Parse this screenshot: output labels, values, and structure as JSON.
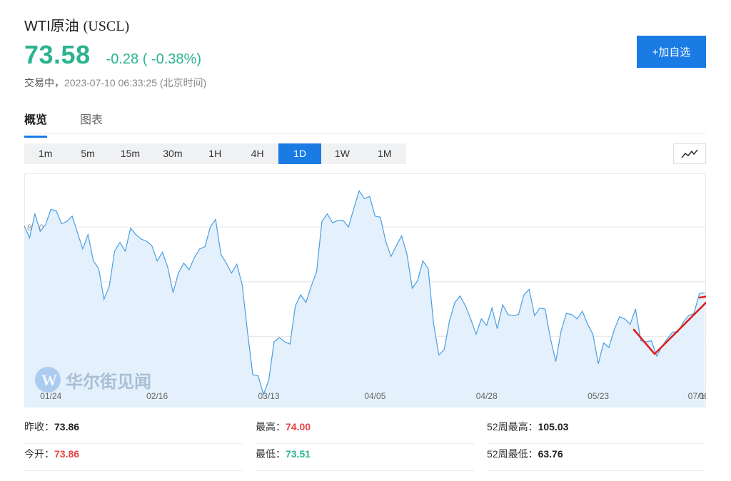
{
  "header": {
    "name": "WTI原油",
    "code": "(USCL)",
    "price": "73.58",
    "change": "-0.28 ( -0.38%)",
    "status_prefix": "交易中，",
    "timestamp": "2023-07-10 06:33:25 (北京时间)",
    "add_button": "+加自选"
  },
  "tabs": [
    {
      "label": "概览",
      "active": true
    },
    {
      "label": "图表",
      "active": false
    }
  ],
  "periods": [
    {
      "label": "1m",
      "active": false
    },
    {
      "label": "5m",
      "active": false
    },
    {
      "label": "15m",
      "active": false
    },
    {
      "label": "30m",
      "active": false
    },
    {
      "label": "1H",
      "active": false
    },
    {
      "label": "4H",
      "active": false
    },
    {
      "label": "1D",
      "active": true
    },
    {
      "label": "1W",
      "active": false
    },
    {
      "label": "1M",
      "active": false
    }
  ],
  "watermark": "华尔街见闻",
  "chart_data": {
    "type": "area",
    "ylim": [
      63.5,
      84.9
    ],
    "yticks": [
      "65.00",
      "70.00",
      "75.00",
      "80.00"
    ],
    "xticks": [
      "01/24",
      "02/16",
      "03/13",
      "04/05",
      "04/28",
      "05/23",
      "06/15",
      "07/1"
    ],
    "x_tick_index": [
      5,
      25,
      46,
      66,
      87,
      108,
      129,
      148
    ],
    "colors": {
      "line": "#4a9fe0",
      "fill": "#e4f0fc",
      "arrow": "#e02020"
    },
    "series": [
      {
        "values": [
          80.1,
          79.0,
          81.2,
          79.6,
          80.2,
          81.6,
          81.5,
          80.3,
          80.5,
          81.0,
          79.5,
          78.0,
          79.3,
          76.9,
          76.2,
          73.4,
          74.6,
          77.8,
          78.6,
          77.8,
          79.9,
          79.3,
          78.9,
          78.7,
          78.3,
          76.9,
          77.7,
          76.3,
          74.0,
          75.8,
          76.7,
          76.1,
          77.2,
          78.0,
          78.2,
          80.0,
          80.7,
          77.5,
          76.7,
          75.8,
          76.6,
          74.7,
          70.4,
          66.5,
          66.4,
          64.7,
          66.0,
          69.5,
          69.9,
          69.5,
          69.3,
          72.8,
          73.8,
          73.1,
          74.6,
          75.9,
          80.5,
          81.2,
          80.4,
          80.6,
          80.6,
          80.0,
          81.7,
          83.3,
          82.6,
          82.8,
          81.0,
          80.9,
          78.7,
          77.3,
          78.3,
          79.2,
          77.5,
          74.4,
          75.1,
          76.9,
          76.2,
          71.2,
          68.3,
          68.8,
          71.4,
          73.1,
          73.7,
          72.8,
          71.6,
          70.2,
          71.6,
          71.0,
          72.6,
          70.7,
          72.9,
          72.0,
          71.9,
          72.0,
          73.8,
          74.3,
          71.9,
          72.6,
          72.5,
          69.8,
          67.7,
          70.5,
          72.1,
          72.0,
          71.6,
          72.3,
          71.1,
          70.2,
          67.5,
          69.4,
          69.0,
          70.6,
          71.8,
          71.6,
          71.1,
          72.5,
          69.6,
          69.5,
          69.6,
          68.2,
          69.1,
          69.8,
          70.4,
          70.4,
          71.3,
          71.9,
          72.1,
          73.9,
          74.0
        ]
      }
    ]
  }
}
